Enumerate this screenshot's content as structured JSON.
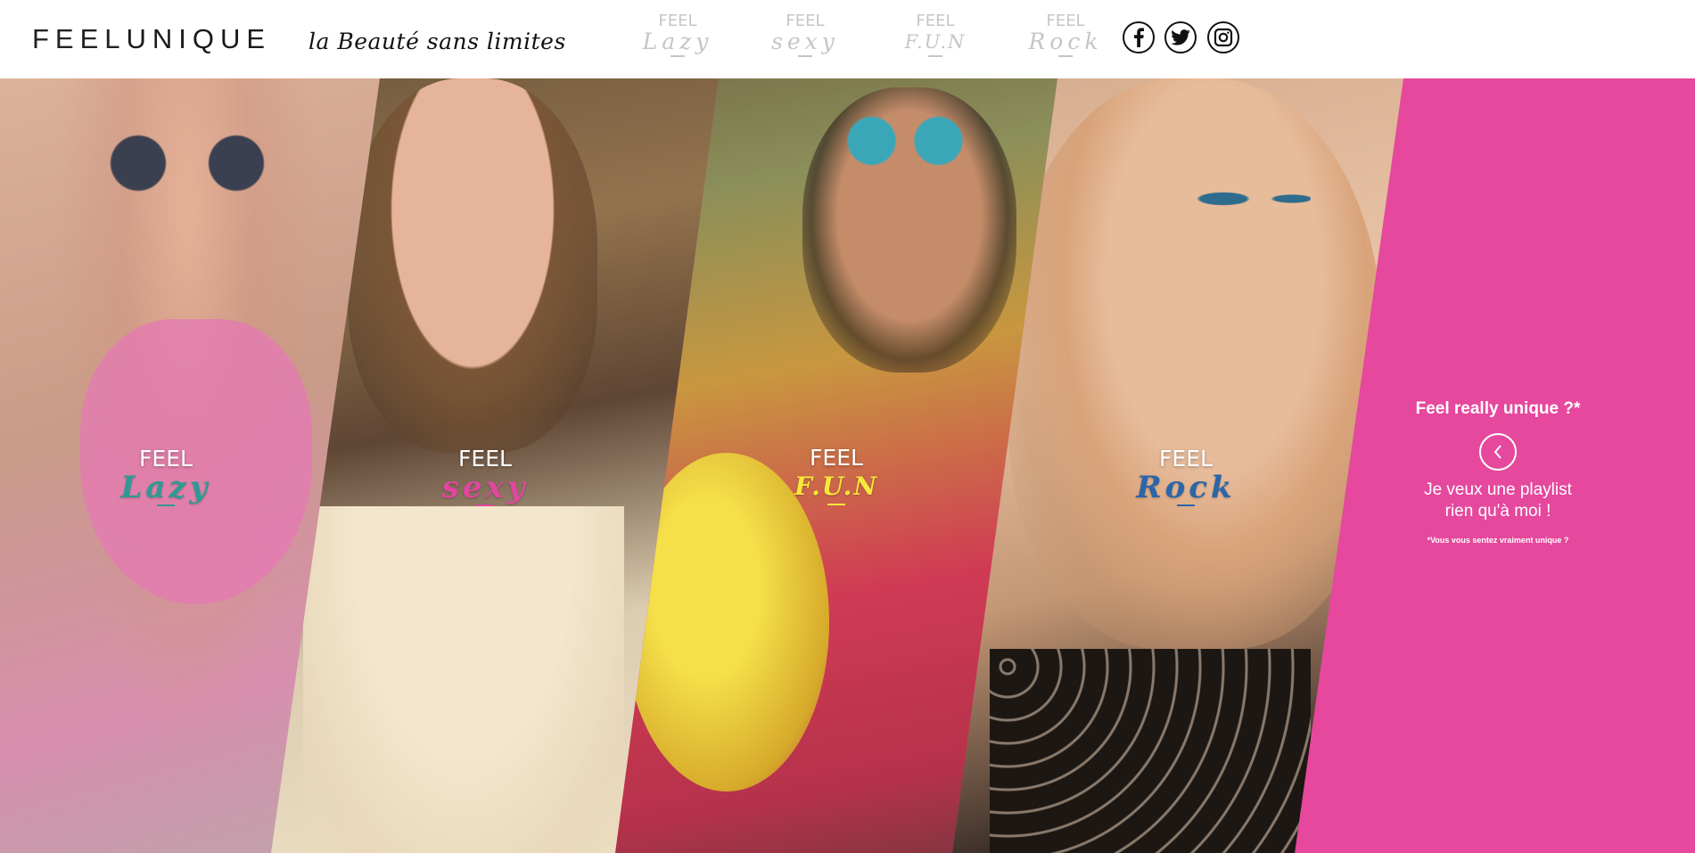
{
  "header": {
    "brand_light": "FEEL",
    "brand_bold": "UNIQUE",
    "tagline": "la Beauté sans limites",
    "nav": [
      {
        "feel": "FEEL",
        "word": "Lazy"
      },
      {
        "feel": "FEEL",
        "word": "sexy"
      },
      {
        "feel": "FEEL",
        "word": "F.U.N"
      },
      {
        "feel": "FEEL",
        "word": "Rock"
      }
    ],
    "social": [
      "facebook-icon",
      "twitter-icon",
      "instagram-icon"
    ]
  },
  "panels": [
    {
      "feel": "FEEL",
      "word": "Lazy",
      "color": "#2e9a93"
    },
    {
      "feel": "FEEL",
      "word": "sexy",
      "color": "#e0479e"
    },
    {
      "feel": "FEEL",
      "word": "F.U.N",
      "color": "#f6e83a"
    },
    {
      "feel": "FEEL",
      "word": "Rock",
      "color": "#2a66a8"
    }
  ],
  "cta": {
    "question": "Feel really unique ?*",
    "message_line1": "Je veux une playlist",
    "message_line2": "rien qu'à moi !",
    "footnote": "*Vous vous sentez vraiment unique ?",
    "icon": "chevron-left-icon"
  },
  "colors": {
    "accent_pink": "#e5489d",
    "nav_gray": "#c6c6c6"
  }
}
